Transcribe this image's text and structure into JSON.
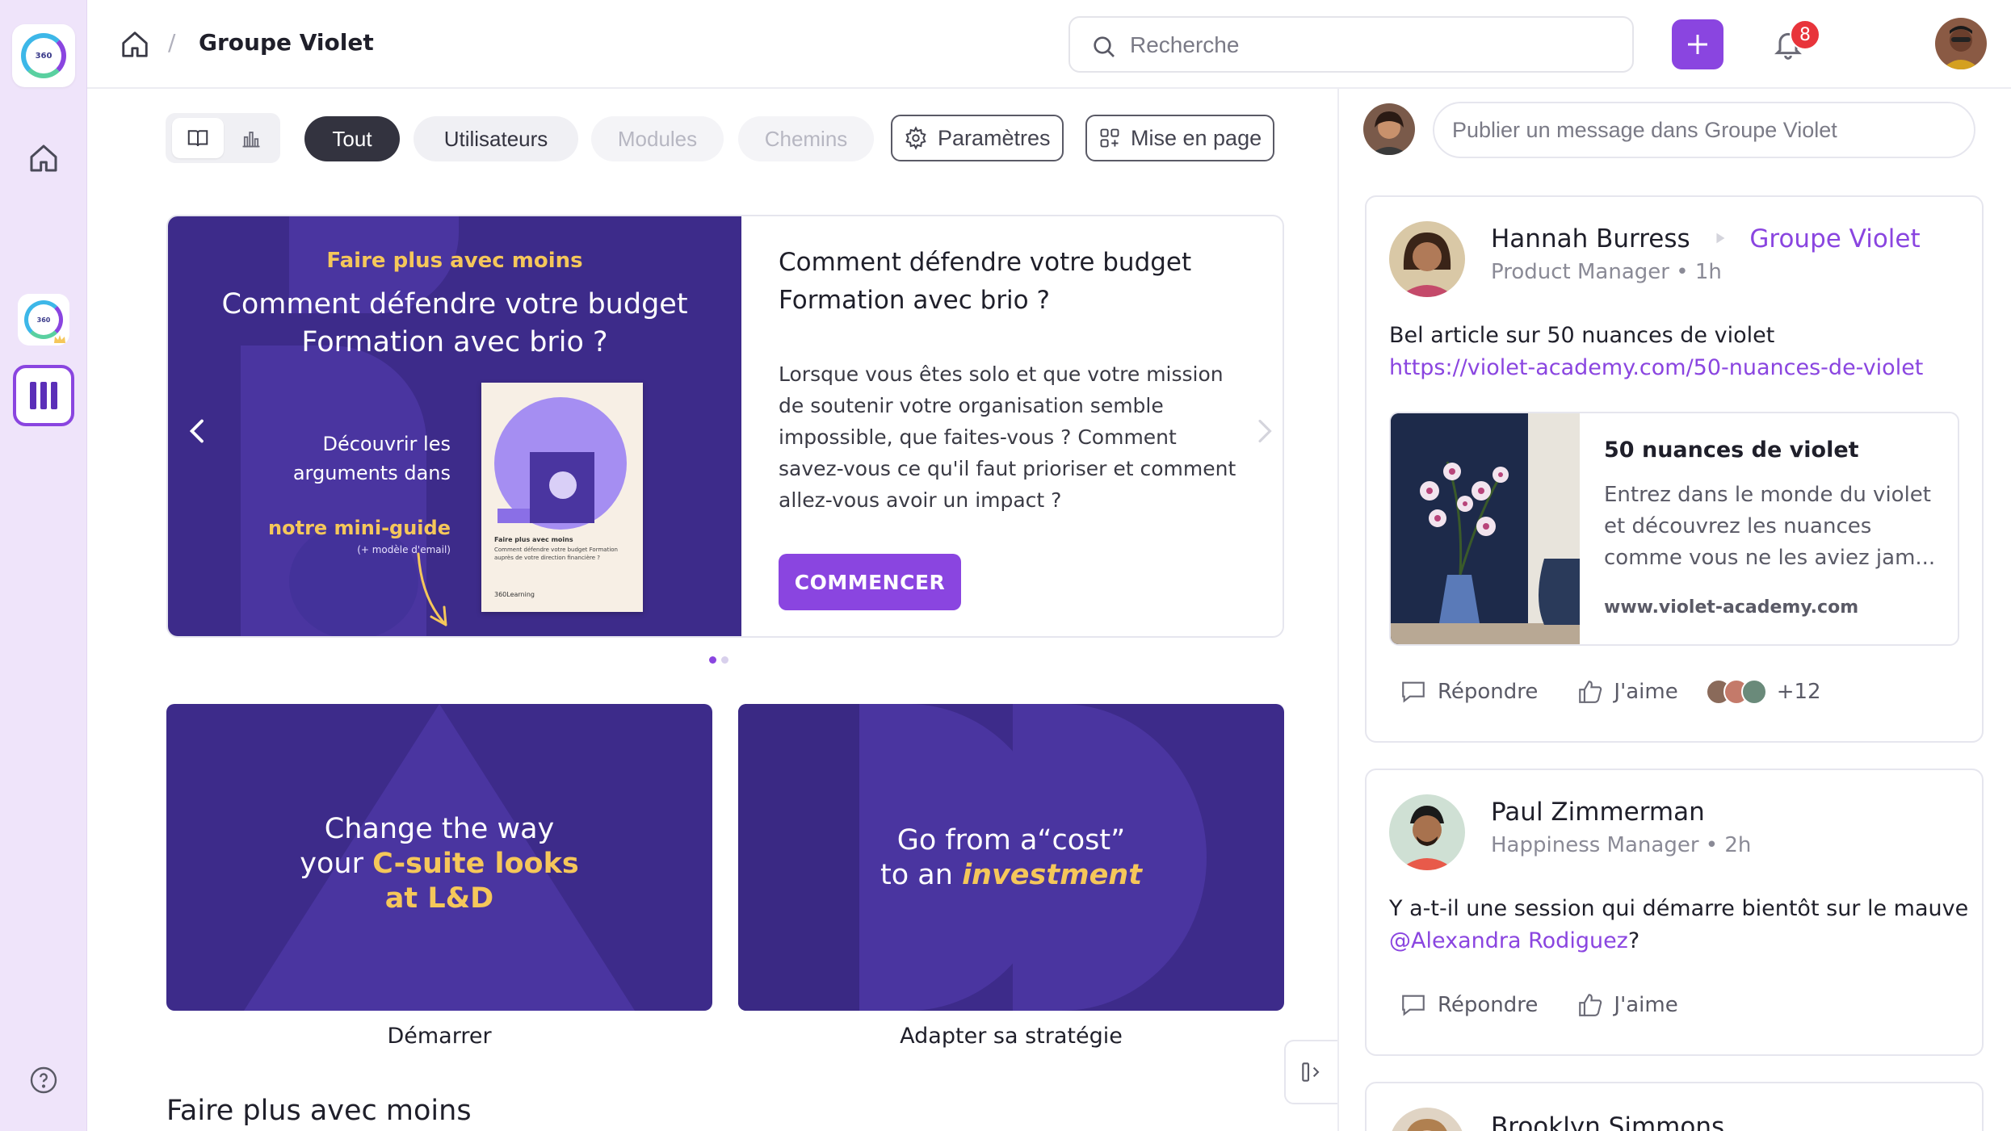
{
  "topbar": {
    "title": "Groupe Violet",
    "crumb_sep": "/",
    "search_placeholder": "Recherche",
    "notification_count": "8"
  },
  "sidebar": {
    "logo_text": "360",
    "app_text": "360",
    "items": [
      "home-icon",
      "app-360-icon",
      "library-icon",
      "help-icon"
    ]
  },
  "toolbar": {
    "filters": [
      {
        "label": "Tout",
        "state": "active"
      },
      {
        "label": "Utilisateurs",
        "state": "normal"
      },
      {
        "label": "Modules",
        "state": "disabled"
      },
      {
        "label": "Chemins",
        "state": "disabled"
      }
    ],
    "settings_label": "Paramètres",
    "layout_label": "Mise en page"
  },
  "hero": {
    "image": {
      "kicker": "Faire plus avec moins",
      "title": "Comment défendre votre budget Formation avec brio ?",
      "discover": "Découvrir les arguments dans",
      "mini_guide": "notre mini-guide",
      "note": "(+ modèle d'email)",
      "book_title": "Faire plus avec moins",
      "book_subtitle": "Comment défendre votre budget Formation auprès de votre direction financière ?",
      "book_brand": "360Learning"
    },
    "title": "Comment défendre votre budget Formation avec brio ?",
    "description": "Lorsque vous êtes solo et que votre mission de soutenir votre organisation semble impossible, que faites-vous ? Comment savez-vous ce qu'il faut prioriser et comment allez-vous avoir un impact ?",
    "cta": "COMMENCER",
    "slide_index": 1,
    "slide_count": 2
  },
  "cards": [
    {
      "line1": "Change the way",
      "line2a": "your ",
      "line2b": "C-suite looks",
      "line3": "at L&D",
      "label": "Démarrer"
    },
    {
      "line1": "Go from a“cost”",
      "line2a": "to an ",
      "line2b": "investment",
      "label": "Adapter sa stratégie"
    }
  ],
  "section_title": "Faire plus avec moins",
  "feed": {
    "compose_placeholder": "Publier un message dans Groupe Violet",
    "posts": [
      {
        "author": "Hannah Burress",
        "group": "Groupe Violet",
        "role_time": "Product Manager • 1h",
        "body": "Bel article sur 50 nuances de violet",
        "link": "https://violet-academy.com/50-nuances-de-violet",
        "preview": {
          "title": "50 nuances de violet",
          "description": "Entrez dans le monde du violet et découvrez les nuances comme vous ne les aviez jam...",
          "url": "www.violet-academy.com"
        },
        "reply_label": "Répondre",
        "like_label": "J'aime",
        "likes_extra": "+12"
      },
      {
        "author": "Paul Zimmerman",
        "role_time": "Happiness Manager • 2h",
        "body": "Y a-t-il une session qui démarre bientôt sur le mauve ",
        "mention": "@Alexandra Rodiguez",
        "body_end": "?",
        "reply_label": "Répondre",
        "like_label": "J'aime"
      },
      {
        "author": "Brooklyn Simmons"
      }
    ]
  },
  "colors": {
    "accent": "#8a45e0",
    "hero_bg": "#3d2b8a",
    "highlight": "#f5c75a",
    "sidebar_bg": "#efe4fa",
    "badge": "#e8343b"
  }
}
